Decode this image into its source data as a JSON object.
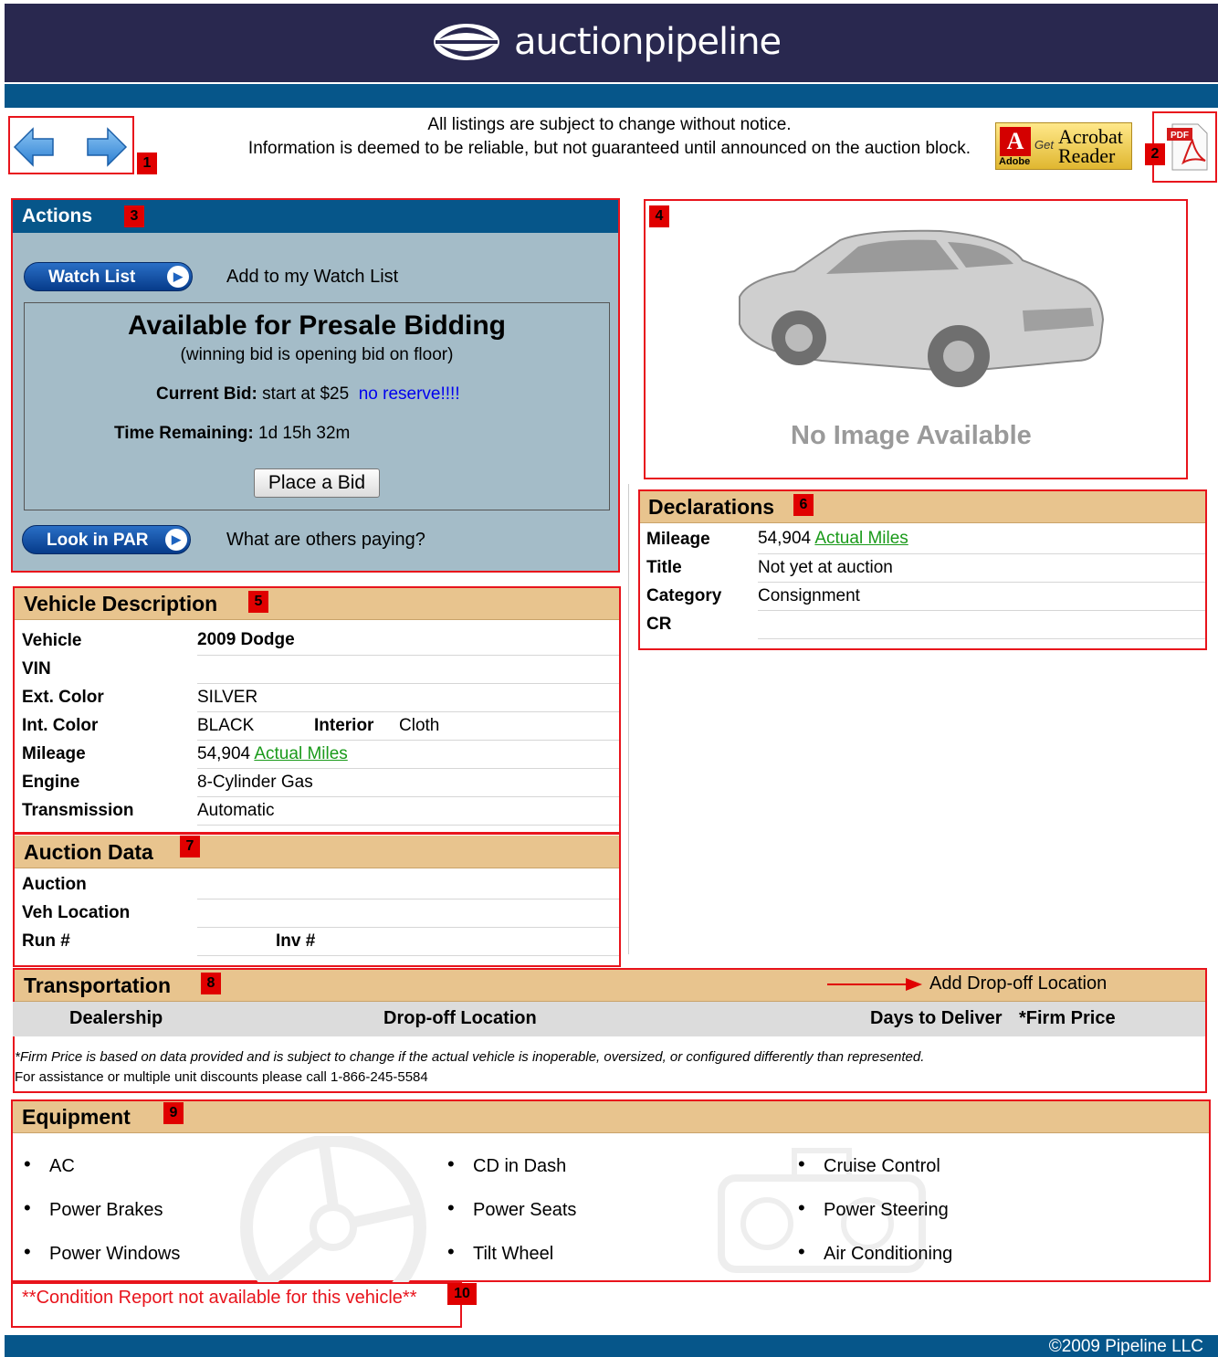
{
  "header": {
    "brand": "auctionpipeline"
  },
  "notice": {
    "line1": "All listings are subject to change without notice.",
    "line2": "Information is deemed to be reliable, but not guaranteed until announced on the auction block."
  },
  "acrobat": {
    "adobe": "Adobe",
    "get": "Get",
    "acrobat": "Acrobat",
    "reader": "Reader"
  },
  "pdf": {
    "label": "PDF"
  },
  "markers": [
    "1",
    "2",
    "3",
    "4",
    "5",
    "6",
    "7",
    "8",
    "9",
    "10"
  ],
  "actions": {
    "title": "Actions",
    "watch_button": "Watch List",
    "watch_label": "Add to my Watch List",
    "presale_title": "Available for Presale Bidding",
    "presale_sub": "(winning bid is opening bid on floor)",
    "current_bid_label": "Current Bid:",
    "current_bid_value": "start at $25",
    "no_reserve": "no reserve!!!!",
    "time_label": "Time Remaining:",
    "time_value": "1d 15h 32m",
    "bid_button": "Place a Bid",
    "par_button": "Look in PAR",
    "par_label": "What are others paying?"
  },
  "image": {
    "no_image": "No Image Available"
  },
  "vehicle": {
    "title": "Vehicle Description",
    "rows": [
      {
        "k": "Vehicle",
        "v": "2009 Dodge"
      },
      {
        "k": "VIN",
        "v": ""
      },
      {
        "k": "Ext. Color",
        "v": "SILVER"
      },
      {
        "k": "Int. Color",
        "v": "BLACK",
        "k2": "Interior",
        "v2": "Cloth"
      },
      {
        "k": "Mileage",
        "v": "54,904",
        "link": "Actual Miles"
      },
      {
        "k": "Engine",
        "v": "8-Cylinder Gas"
      },
      {
        "k": "Transmission",
        "v": "Automatic"
      }
    ]
  },
  "declarations": {
    "title": "Declarations",
    "rows": [
      {
        "k": "Mileage",
        "v": "54,904",
        "link": "Actual Miles"
      },
      {
        "k": "Title",
        "v": "Not yet at auction"
      },
      {
        "k": "Category",
        "v": "Consignment"
      },
      {
        "k": "CR",
        "v": ""
      }
    ]
  },
  "auction": {
    "title": "Auction Data",
    "rows": [
      {
        "k": "Auction",
        "v": ""
      },
      {
        "k": "Veh Location",
        "v": ""
      },
      {
        "k": "Run #",
        "v": "",
        "k2": "Inv #"
      }
    ]
  },
  "transport": {
    "title": "Transportation",
    "add_dropoff": "Add Drop-off Location",
    "cols": [
      "Dealership",
      "Drop-off Location",
      "Days to Deliver",
      "*Firm Price"
    ],
    "note": "*Firm Price is based on data provided and is subject to change if the actual vehicle is inoperable, oversized, or configured differently than represented.",
    "assist": "For assistance or multiple unit discounts please call 1-866-245-5584"
  },
  "equipment": {
    "title": "Equipment",
    "col1": [
      "AC",
      "Power Brakes",
      "Power Windows"
    ],
    "col2": [
      "CD in Dash",
      "Power Seats",
      "Tilt Wheel"
    ],
    "col3": [
      "Cruise Control",
      "Power Steering",
      "Air Conditioning"
    ]
  },
  "condition": {
    "text": "**Condition Report not available for this vehicle**"
  },
  "footer": {
    "copyright": "©2009 Pipeline LLC"
  },
  "colors": {
    "header": "#29284f",
    "bar": "#06568a",
    "section": "#e8c48e",
    "action_bg": "#a4bcc8",
    "marker": "#e00000"
  }
}
